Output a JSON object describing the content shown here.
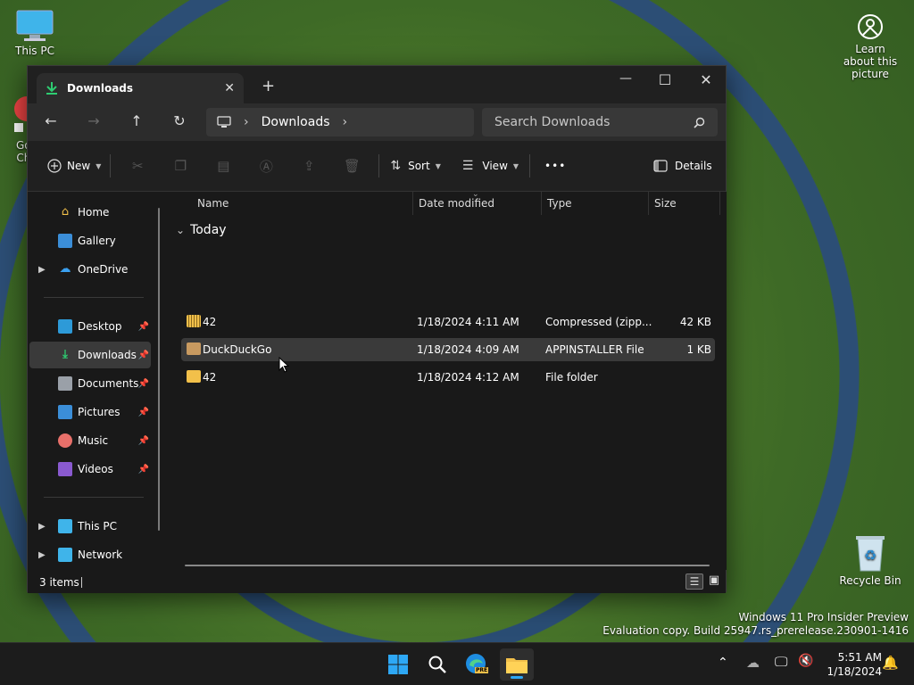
{
  "desktop": {
    "this_pc_label": "This PC",
    "partial_label_1": "Go",
    "partial_label_2": "Ch",
    "learn_label": "Learn about this picture",
    "recycle_label": "Recycle Bin",
    "watermark_line1": "Windows 11 Pro Insider Preview",
    "watermark_line2": "Evaluation copy. Build 25947.rs_prerelease.230901-1416"
  },
  "window": {
    "tab_title": "Downloads",
    "tab_close": "✕",
    "new_tab": "+",
    "minimize": "—",
    "maximize": "☐",
    "close": "✕"
  },
  "nav": {
    "back": "←",
    "forward": "→",
    "up": "↑",
    "refresh": "↻",
    "address_path": "Downloads",
    "address_sep": "›",
    "search_placeholder": "Search Downloads"
  },
  "commands": {
    "new_label": "New",
    "sort_label": "Sort",
    "view_label": "View",
    "more_label": "•••",
    "details_label": "Details"
  },
  "sidebar": {
    "items": [
      {
        "label": "Home"
      },
      {
        "label": "Gallery"
      },
      {
        "label": "OneDrive"
      },
      {
        "label": "Desktop"
      },
      {
        "label": "Downloads"
      },
      {
        "label": "Documents"
      },
      {
        "label": "Pictures"
      },
      {
        "label": "Music"
      },
      {
        "label": "Videos"
      },
      {
        "label": "This PC"
      },
      {
        "label": "Network"
      }
    ]
  },
  "columns": {
    "name": "Name",
    "date": "Date modified",
    "type": "Type",
    "size": "Size"
  },
  "group_label": "Today",
  "group_chevron": "⌄",
  "files": [
    {
      "name": "42",
      "date": "1/18/2024 4:11 AM",
      "type": "Compressed (zipp...",
      "size": "42 KB",
      "icon": "zip-folder-icon"
    },
    {
      "name": "DuckDuckGo",
      "date": "1/18/2024 4:09 AM",
      "type": "APPINSTALLER File",
      "size": "1 KB",
      "icon": "package-icon"
    },
    {
      "name": "42",
      "date": "1/18/2024 4:12 AM",
      "type": "File folder",
      "size": "",
      "icon": "folder-icon"
    }
  ],
  "status": {
    "items_count": "3 items"
  },
  "taskbar": {
    "time": "5:51 AM",
    "date": "1/18/2024",
    "edge_badge": "PRE"
  },
  "colors": {
    "accent": "#0078d4",
    "folder": "#f2c04a",
    "window_bg": "#191919"
  }
}
